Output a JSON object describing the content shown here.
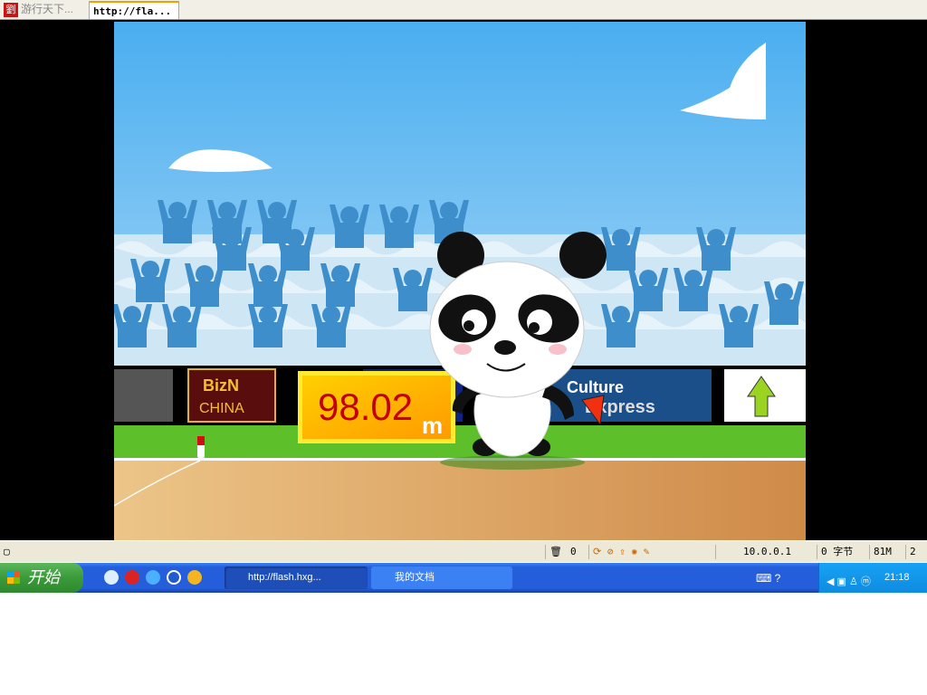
{
  "tabs": [
    {
      "label": "游行天下...",
      "logo": "劉"
    },
    {
      "label": "http://fla..."
    }
  ],
  "game": {
    "distance": "98.02",
    "unit": "m",
    "billboards": [
      "BizN",
      "CHINA",
      "Culture",
      "Express"
    ]
  },
  "statusbar": {
    "count": "0",
    "ip": "10.0.0.1",
    "bytes": "0 字节",
    "memory": "81M",
    "extra": "2"
  },
  "taskbar": {
    "start_label": "开始",
    "tasks": [
      {
        "label": "http://flash.hxg..."
      },
      {
        "label": "我的文档"
      }
    ],
    "clock": "21:18"
  }
}
